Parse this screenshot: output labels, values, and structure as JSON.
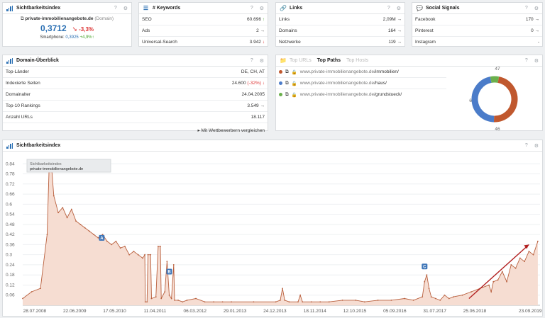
{
  "sichtbarkeit": {
    "title": "Sichtbarkeitsindex",
    "domain": "private-immobilienangebote.de",
    "domain_tag": "(Domain)",
    "value": "0,3712",
    "change": "-3,3%",
    "smartphone_label": "Smartphone:",
    "smartphone_value": "0,3925",
    "smartphone_change": "+4,9%"
  },
  "keywords": {
    "title": "# Keywords",
    "rows": [
      {
        "label": "SEO",
        "value": "60.696"
      },
      {
        "label": "Ads",
        "value": "2"
      },
      {
        "label": "Universal-Search",
        "value": "3.942"
      }
    ]
  },
  "links": {
    "title": "Links",
    "rows": [
      {
        "label": "Links",
        "value": "2,09M"
      },
      {
        "label": "Domains",
        "value": "164"
      },
      {
        "label": "Netzwerke",
        "value": "119"
      }
    ]
  },
  "social": {
    "title": "Social Signals",
    "rows": [
      {
        "label": "Facebook",
        "value": "170"
      },
      {
        "label": "Pinterest",
        "value": "0"
      },
      {
        "label": "Instagram",
        "value": "-"
      }
    ]
  },
  "overview": {
    "title": "Domain-Überblick",
    "rows": [
      {
        "label": "Top-Länder",
        "value": "DE, CH, AT"
      },
      {
        "label": "Indexierte Seiten",
        "value": "24.600",
        "change": "(-32%)"
      },
      {
        "label": "Domainalter",
        "value": "24.04.2005"
      },
      {
        "label": "Top-10 Rankings",
        "value": "3.549"
      },
      {
        "label": "Anzahl URLs",
        "value": "18.117"
      }
    ],
    "compare_label": "Mit Wettbewerbern vergleichen"
  },
  "paths": {
    "tabs": [
      "Top URLs",
      "Top Paths",
      "Top Hosts"
    ],
    "host": "www.private-immobilienangebote.de",
    "items": [
      {
        "path": "/immobilien/",
        "color": "#c0582e"
      },
      {
        "path": "/haus/",
        "color": "#4b7cc9"
      },
      {
        "path": "/grundstueck/",
        "color": "#6ab04c"
      }
    ],
    "donut_labels": [
      "47",
      "46",
      "6"
    ]
  },
  "donut_data": {
    "type": "pie",
    "values": [
      47,
      46,
      6
    ],
    "colors": [
      "#c0582e",
      "#4b7cc9",
      "#6ab04c"
    ]
  },
  "chart": {
    "title": "Sichtbarkeitsindex",
    "tooltip_title": "Sichtbarkeitsindex",
    "tooltip_domain": "private-immobilienangebote.de",
    "markers": [
      {
        "label": "A",
        "x": 2010.08,
        "y": 0.4
      },
      {
        "label": "B",
        "x": 2011.6,
        "y": 0.2
      },
      {
        "label": "C",
        "x": 2017.35,
        "y": 0.23
      }
    ]
  },
  "chart_data": {
    "type": "area",
    "y_ticks": [
      0.06,
      0.12,
      0.18,
      0.24,
      0.3,
      0.36,
      0.42,
      0.48,
      0.54,
      0.6,
      0.66,
      0.72,
      0.78,
      0.84
    ],
    "y_ticks_labels": [
      "0.06",
      "0.12",
      "0.18",
      "0.24",
      "0.3",
      "0.36",
      "0.42",
      "0.48",
      "0.54",
      "0.6",
      "0.66",
      "0.72",
      "0.78",
      "0.84"
    ],
    "ylim": [
      0,
      0.9
    ],
    "xlim": [
      2008.3,
      2019.95
    ],
    "x_tick_labels": [
      "28.07.2008",
      "22.06.2009",
      "17.05.2010",
      "11.04.2011",
      "06.03.2012",
      "29.01.2013",
      "24.12.2013",
      "18.11.2014",
      "12.10.2015",
      "05.09.2016",
      "31.07.2017",
      "25.06.2018",
      "23.09.2019"
    ],
    "x_tick_values": [
      2008.57,
      2009.47,
      2010.37,
      2011.28,
      2012.18,
      2013.08,
      2013.98,
      2014.88,
      2015.78,
      2016.68,
      2017.58,
      2018.48,
      2019.73
    ],
    "series": [
      {
        "x": [
          2008.3,
          2008.5,
          2008.7,
          2008.85,
          2008.9,
          2008.95,
          2009.0,
          2009.1,
          2009.2,
          2009.3,
          2009.4,
          2009.5,
          2009.6,
          2009.7,
          2009.8,
          2009.9,
          2010.0,
          2010.1,
          2010.2,
          2010.3,
          2010.4,
          2010.5,
          2010.6,
          2010.7,
          2010.8,
          2010.9,
          2011.0,
          2011.05,
          2011.06,
          2011.1,
          2011.12,
          2011.18,
          2011.2,
          2011.3,
          2011.35,
          2011.4,
          2011.42,
          2011.5,
          2011.55,
          2011.6,
          2011.65,
          2011.7,
          2011.72,
          2011.8,
          2011.9,
          2012.0,
          2012.2,
          2012.4,
          2012.6,
          2012.8,
          2013.0,
          2013.5,
          2014.0,
          2014.1,
          2014.15,
          2014.2,
          2014.3,
          2014.5,
          2014.55,
          2014.6,
          2014.8,
          2015.0,
          2015.2,
          2015.5,
          2015.8,
          2016.0,
          2016.3,
          2016.6,
          2016.9,
          2017.1,
          2017.3,
          2017.35,
          2017.4,
          2017.45,
          2017.5,
          2017.6,
          2017.7,
          2017.8,
          2017.9,
          2018.0,
          2018.2,
          2018.4,
          2018.6,
          2018.8,
          2018.85,
          2018.9,
          2019.0,
          2019.1,
          2019.2,
          2019.3,
          2019.4,
          2019.5,
          2019.6,
          2019.7,
          2019.8,
          2019.9
        ],
        "y": [
          0.04,
          0.08,
          0.1,
          0.42,
          0.86,
          0.82,
          0.65,
          0.55,
          0.58,
          0.52,
          0.57,
          0.5,
          0.48,
          0.46,
          0.44,
          0.42,
          0.4,
          0.42,
          0.38,
          0.36,
          0.38,
          0.34,
          0.35,
          0.3,
          0.32,
          0.3,
          0.28,
          0.3,
          0.02,
          0.02,
          0.3,
          0.3,
          0.04,
          0.05,
          0.35,
          0.35,
          0.04,
          0.08,
          0.26,
          0.06,
          0.04,
          0.24,
          0.03,
          0.03,
          0.02,
          0.03,
          0.04,
          0.02,
          0.02,
          0.02,
          0.02,
          0.02,
          0.02,
          0.03,
          0.1,
          0.03,
          0.02,
          0.02,
          0.06,
          0.02,
          0.02,
          0.02,
          0.02,
          0.03,
          0.03,
          0.02,
          0.03,
          0.03,
          0.04,
          0.03,
          0.05,
          0.14,
          0.18,
          0.1,
          0.05,
          0.04,
          0.03,
          0.06,
          0.04,
          0.05,
          0.06,
          0.08,
          0.1,
          0.12,
          0.08,
          0.14,
          0.15,
          0.2,
          0.14,
          0.24,
          0.22,
          0.28,
          0.26,
          0.32,
          0.3,
          0.38
        ]
      }
    ]
  }
}
